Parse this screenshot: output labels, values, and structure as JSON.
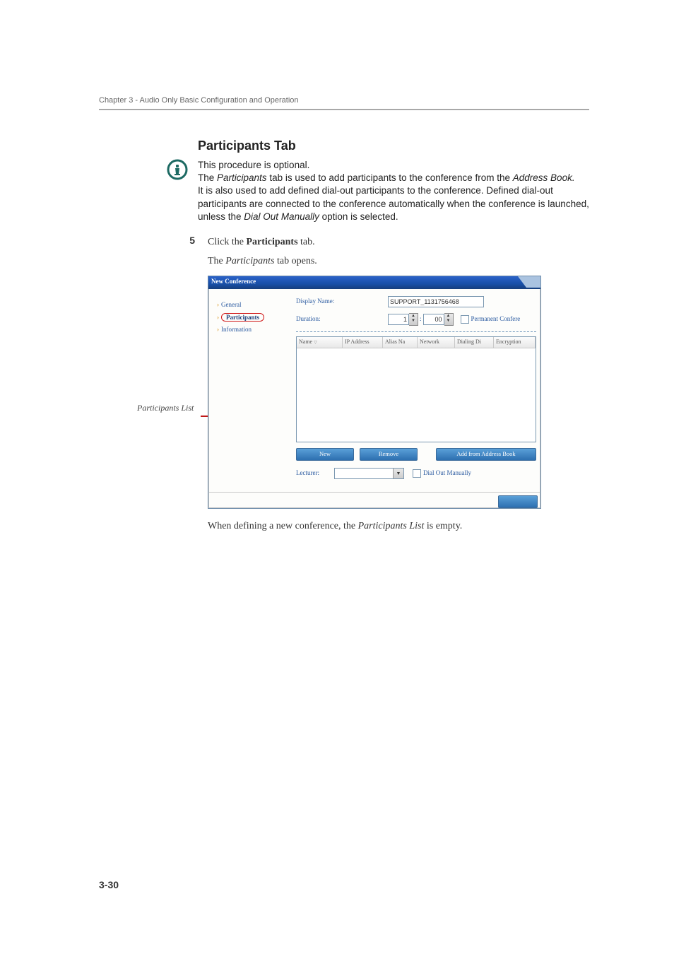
{
  "chapter_header": "Chapter 3 - Audio Only Basic Configuration and Operation",
  "section_title": "Participants Tab",
  "info": {
    "line1": "This procedure is optional.",
    "line2_a": "The ",
    "line2_b": "Participants",
    "line2_c": " tab is used to add participants to the conference from the ",
    "line2_d": "Address Book.",
    "line3_a": "It is also used to add defined dial-out participants to the conference. Defined dial-out participants are connected to the conference automatically when the conference is launched, unless the ",
    "line3_b": "Dial Out Manually",
    "line3_c": " option is selected."
  },
  "step": {
    "num": "5",
    "text_a": "Click the ",
    "text_b": "Participants",
    "text_c": " tab.",
    "sub_a": "The ",
    "sub_b": "Participants",
    "sub_c": " tab opens."
  },
  "dlg": {
    "title": "New Conference",
    "nav": {
      "general": "General",
      "participants": "Participants",
      "information": "Information"
    },
    "display_name_label": "Display Name:",
    "display_name_value": "SUPPORT_1131756468",
    "duration_label": "Duration:",
    "duration_h": "1",
    "duration_sep": ":",
    "duration_m": "00",
    "permanent_label": "Permanent Confere",
    "cols": {
      "name": "Name",
      "ip": "IP Address",
      "alias": "Alias Na",
      "network": "Network",
      "dialing": "Dialing Di",
      "encryption": "Encryption"
    },
    "btn_new": "New",
    "btn_remove": "Remove",
    "btn_add_ab": "Add from Address Book",
    "lecturer_label": "Lecturer:",
    "dial_out_label": "Dial Out Manually"
  },
  "callout": "Participants List",
  "closing_a": "When defining a new conference, the ",
  "closing_b": "Participants List",
  "closing_c": " is empty.",
  "page_num": "3-30"
}
